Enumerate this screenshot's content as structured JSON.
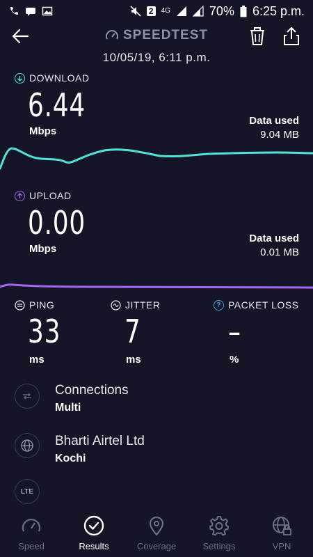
{
  "status_bar": {
    "battery": "70%",
    "time": "6:25 p.m.",
    "sim_badge": "2",
    "network": "4G"
  },
  "header": {
    "title": "SPEEDTEST",
    "datetime": "10/05/19, 6:11 p.m."
  },
  "download": {
    "label": "DOWNLOAD",
    "value": "6.44",
    "unit": "Mbps",
    "data_used_label": "Data used",
    "data_used_value": "9.04 MB",
    "color": "#4fe3d9"
  },
  "upload": {
    "label": "UPLOAD",
    "value": "0.00",
    "unit": "Mbps",
    "data_used_label": "Data used",
    "data_used_value": "0.01 MB",
    "color": "#a565f0"
  },
  "metrics": {
    "ping": {
      "label": "PING",
      "value": "33",
      "unit": "ms"
    },
    "jitter": {
      "label": "JITTER",
      "value": "7",
      "unit": "ms"
    },
    "packet_loss": {
      "label": "PACKET LOSS",
      "value": "–",
      "unit": "%",
      "color": "#3ba7e8"
    }
  },
  "details": {
    "connections": {
      "title": "Connections",
      "value": "Multi"
    },
    "provider": {
      "title": "Bharti Airtel Ltd",
      "value": "Kochi"
    },
    "lte_badge": "LTE"
  },
  "nav": {
    "items": [
      {
        "label": "Speed"
      },
      {
        "label": "Results"
      },
      {
        "label": "Coverage"
      },
      {
        "label": "Settings"
      },
      {
        "label": "VPN"
      }
    ]
  }
}
